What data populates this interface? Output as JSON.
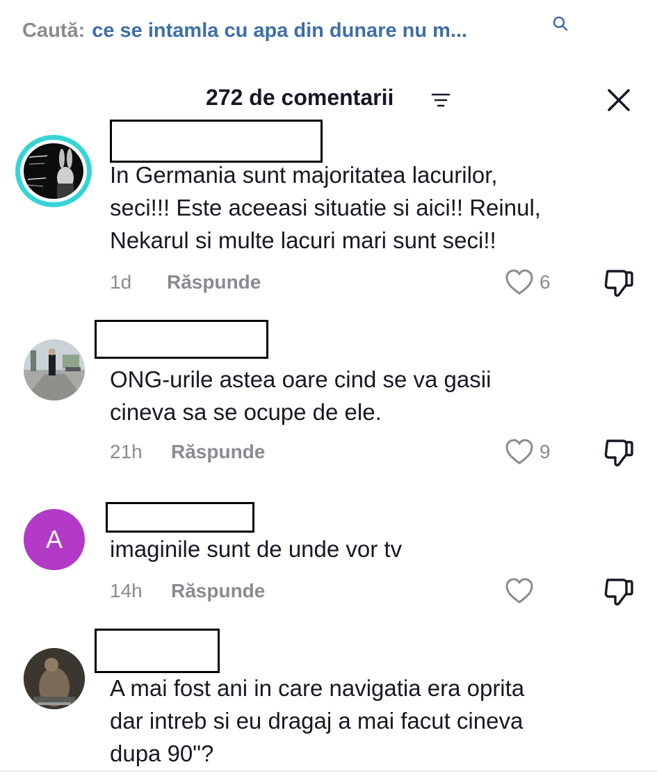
{
  "search": {
    "label": "Caută:",
    "query": "ce se intamla cu apa din dunare nu m..."
  },
  "header": {
    "title": "272 de comentarii"
  },
  "comments": [
    {
      "avatar_icon": "bugs-bunny-avatar",
      "text_lines": [
        "In Germania sunt majoritatea lacurilor,",
        "seci!!! Este aceeasi situatie si aici!! Reinul,",
        "Nekarul si multe lacuri mari sunt seci!!"
      ],
      "time": "1d",
      "reply_label": "Răspunde",
      "likes": "6"
    },
    {
      "avatar_icon": "person-photo-avatar",
      "text_lines": [
        "ONG-urile astea oare cind se va gasii",
        "cineva sa se ocupe de ele."
      ],
      "time": "21h",
      "reply_label": "Răspunde",
      "likes": "9"
    },
    {
      "avatar_icon": "letter-avatar",
      "avatar_letter": "A",
      "avatar_color": "#b23ac7",
      "text_lines": [
        "imaginile sunt de unde vor tv"
      ],
      "time": "14h",
      "reply_label": "Răspunde",
      "likes": ""
    },
    {
      "avatar_icon": "statue-photo-avatar",
      "text_lines": [
        "A mai fost ani in care navigatia era oprita",
        "dar intreb si eu dragaj a mai facut cineva",
        "dupa 90\"?"
      ]
    }
  ],
  "colors": {
    "accent_query": "#3e6ea8",
    "muted_text": "#8a8b91",
    "primary_text": "#161823",
    "story_ring_teal": "#35d5d6"
  }
}
